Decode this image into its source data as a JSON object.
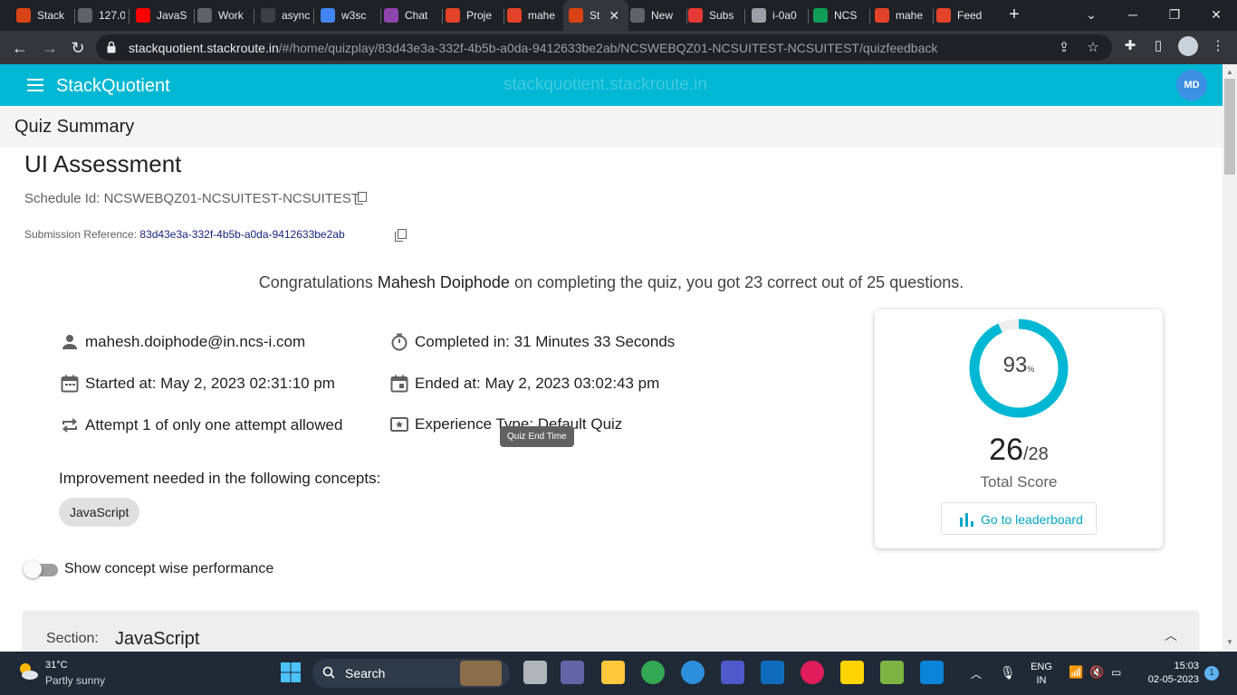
{
  "browser": {
    "tabs": [
      {
        "label": "Stack",
        "color": "#d84315"
      },
      {
        "label": "127.0",
        "color": "#5f6368"
      },
      {
        "label": "JavaS",
        "color": "#ff0000"
      },
      {
        "label": "Work",
        "color": "#5f6368"
      },
      {
        "label": "async",
        "color": "#3c4043"
      },
      {
        "label": "w3sc",
        "color": "#4285f4"
      },
      {
        "label": "Chat",
        "color": "#8e44ad"
      },
      {
        "label": "Proje",
        "color": "#e24329"
      },
      {
        "label": "mahe",
        "color": "#e24329"
      },
      {
        "label": "St",
        "color": "#d84315"
      },
      {
        "label": "New",
        "color": "#5f6368"
      },
      {
        "label": "Subs",
        "color": "#e53935"
      },
      {
        "label": "i-0a0",
        "color": "#9aa0a6"
      },
      {
        "label": "NCS",
        "color": "#0f9d58"
      },
      {
        "label": "mahe",
        "color": "#e24329"
      },
      {
        "label": "Feed",
        "color": "#e24329"
      }
    ],
    "url_host": "stackquotient.stackroute.in",
    "url_path": "/#/home/quizplay/83d43e3a-332f-4b5b-a0da-9412633be2ab/NCSWEBQZ01-NCSUITEST-NCSUITEST/quizfeedback"
  },
  "app": {
    "title": "StackQuotient",
    "watermark": "stackquotient.stackroute.in",
    "avatar": "MD"
  },
  "page": {
    "header": "Quiz Summary",
    "quiz_title": "UI Assessment",
    "schedule_label": "Schedule Id: ",
    "schedule_id": "NCSWEBQZ01-NCSUITEST-NCSUITEST",
    "submission_label": "Submission Reference: ",
    "submission_ref": "83d43e3a-332f-4b5b-a0da-9412633be2ab",
    "congrats_prefix": "Congratulations ",
    "user_name": "Mahesh Doiphode",
    "congrats_suffix": " on completing the quiz, you got 23 correct out of 25 questions.",
    "email": "mahesh.doiphode@in.ncs-i.com",
    "completed_in": "Completed in: 31 Minutes 33 Seconds",
    "started_at": "Started at: May 2, 2023 02:31:10 pm",
    "ended_at": "Ended at: May 2, 2023 03:02:43 pm",
    "attempt": "Attempt 1 of only one attempt allowed",
    "experience": "Experience Type: Default Quiz",
    "tooltip": "Quiz End Time",
    "concepts_heading": "Improvement needed in the following concepts:",
    "concepts": [
      "JavaScript"
    ],
    "toggle_label": "Show concept wise performance",
    "section_label": "Section:",
    "section_value": "JavaScript"
  },
  "score_card": {
    "percent": 93,
    "percent_text": "93",
    "percent_sign": "%",
    "score": "26",
    "total": "/28",
    "score_label": "Total Score",
    "leaderboard_label": "Go to leaderboard",
    "ring_color": "#00b8d4"
  },
  "taskbar": {
    "temp": "31°C",
    "weather": "Partly sunny",
    "search": "Search",
    "lang1": "ENG",
    "lang2": "IN",
    "time": "15:03",
    "date": "02-05-2023",
    "notifications": "1"
  }
}
